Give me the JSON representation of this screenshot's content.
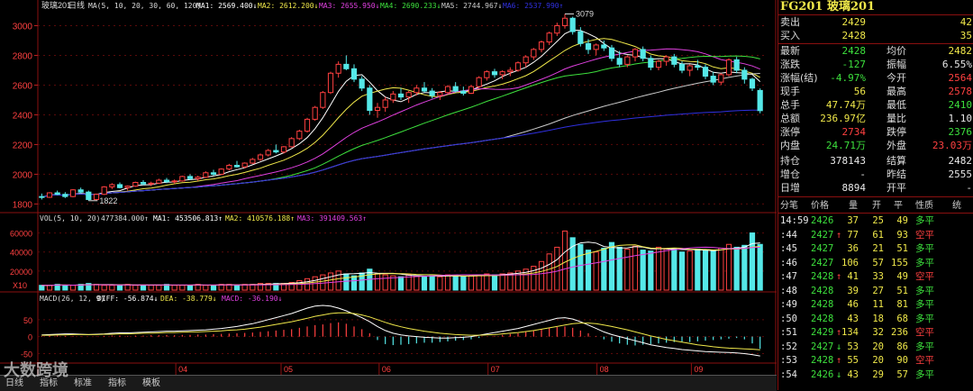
{
  "chart_title_bar": {
    "symbol": "玻璃201",
    "period": "日线",
    "ma_spec": "MA(5, 10, 20, 30, 60, 120)",
    "ma_values": [
      {
        "name": "MA1:",
        "value": "2569.400",
        "arrow": "↓",
        "color": "#ffffff"
      },
      {
        "name": "MA2:",
        "value": "2612.200",
        "arrow": "↓",
        "color": "#f0e84a"
      },
      {
        "name": "MA3:",
        "value": "2655.950",
        "arrow": "↓",
        "color": "#e040e0"
      },
      {
        "name": "MA4:",
        "value": "2690.233",
        "arrow": "↓",
        "color": "#3de03d"
      },
      {
        "name": "MA5:",
        "value": "2744.967",
        "arrow": "↓",
        "color": "#cccccc"
      },
      {
        "name": "MA6:",
        "value": "2537.990",
        "arrow": "↑",
        "color": "#3030e0"
      }
    ]
  },
  "vol_title_bar": {
    "spec": "VOL(5, 10, 20)",
    "value": "477384.000",
    "arrow": "↑",
    "ma_values": [
      {
        "name": "MA1:",
        "value": "453506.813",
        "arrow": "↑",
        "color": "#ffffff"
      },
      {
        "name": "MA2:",
        "value": "410576.188",
        "arrow": "↑",
        "color": "#f0e84a"
      },
      {
        "name": "MA3:",
        "value": "391409.563",
        "arrow": "↑",
        "color": "#e040e0"
      }
    ]
  },
  "macd_title_bar": {
    "spec": "MACD(26, 12, 9)",
    "diff_label": "DIFF:",
    "diff": "-56.874",
    "diff_arrow": "↓",
    "dea_label": "DEA:",
    "dea": "-38.779",
    "dea_arrow": "↓",
    "macd_label": "MACD:",
    "macd": "-36.190",
    "macd_arrow": "↓"
  },
  "price_axis_labels": [
    "3000",
    "2800",
    "2600",
    "2400",
    "2200",
    "2000",
    "1800"
  ],
  "vol_axis_labels": [
    "60000",
    "40000",
    "20000"
  ],
  "vol_unit": "X10",
  "macd_axis_labels": [
    "50",
    "0",
    "-50"
  ],
  "month_labels": [
    "04",
    "05",
    "06",
    "07",
    "08",
    "09"
  ],
  "annotations": {
    "high": "3079",
    "low": "1822"
  },
  "chart_data": {
    "type": "candlestick",
    "price_range": [
      1760,
      3100
    ],
    "ohlc": [
      [
        1850,
        1870,
        1830,
        1845
      ],
      [
        1845,
        1880,
        1840,
        1875
      ],
      [
        1875,
        1890,
        1860,
        1865
      ],
      [
        1865,
        1880,
        1840,
        1850
      ],
      [
        1850,
        1900,
        1845,
        1895
      ],
      [
        1895,
        1910,
        1870,
        1880
      ],
      [
        1880,
        1890,
        1822,
        1830
      ],
      [
        1830,
        1870,
        1825,
        1865
      ],
      [
        1865,
        1920,
        1860,
        1915
      ],
      [
        1915,
        1940,
        1900,
        1930
      ],
      [
        1930,
        1945,
        1905,
        1910
      ],
      [
        1910,
        1925,
        1890,
        1920
      ],
      [
        1920,
        1950,
        1915,
        1945
      ],
      [
        1945,
        1960,
        1925,
        1935
      ],
      [
        1935,
        1950,
        1920,
        1940
      ],
      [
        1940,
        1970,
        1935,
        1960
      ],
      [
        1960,
        1975,
        1940,
        1950
      ],
      [
        1950,
        1965,
        1935,
        1955
      ],
      [
        1955,
        1990,
        1950,
        1985
      ],
      [
        1985,
        2000,
        1960,
        1970
      ],
      [
        1970,
        1990,
        1955,
        1980
      ],
      [
        1980,
        2020,
        1975,
        2010
      ],
      [
        2010,
        2030,
        1990,
        2000
      ],
      [
        2000,
        2040,
        1995,
        2035
      ],
      [
        2035,
        2070,
        2025,
        2060
      ],
      [
        2060,
        2090,
        2045,
        2050
      ],
      [
        2050,
        2080,
        2040,
        2075
      ],
      [
        2075,
        2110,
        2070,
        2100
      ],
      [
        2100,
        2140,
        2090,
        2130
      ],
      [
        2130,
        2170,
        2120,
        2160
      ],
      [
        2160,
        2200,
        2140,
        2150
      ],
      [
        2150,
        2190,
        2140,
        2185
      ],
      [
        2185,
        2250,
        2180,
        2240
      ],
      [
        2240,
        2300,
        2230,
        2290
      ],
      [
        2290,
        2380,
        2280,
        2370
      ],
      [
        2370,
        2460,
        2360,
        2450
      ],
      [
        2450,
        2560,
        2440,
        2550
      ],
      [
        2550,
        2690,
        2540,
        2680
      ],
      [
        2680,
        2760,
        2650,
        2740
      ],
      [
        2740,
        2800,
        2700,
        2710
      ],
      [
        2710,
        2740,
        2620,
        2640
      ],
      [
        2640,
        2660,
        2560,
        2580
      ],
      [
        2580,
        2600,
        2400,
        2430
      ],
      [
        2430,
        2480,
        2380,
        2450
      ],
      [
        2450,
        2520,
        2420,
        2500
      ],
      [
        2500,
        2560,
        2480,
        2540
      ],
      [
        2540,
        2580,
        2500,
        2520
      ],
      [
        2520,
        2560,
        2480,
        2550
      ],
      [
        2550,
        2600,
        2530,
        2580
      ],
      [
        2580,
        2620,
        2550,
        2560
      ],
      [
        2560,
        2580,
        2510,
        2530
      ],
      [
        2530,
        2560,
        2500,
        2550
      ],
      [
        2550,
        2600,
        2540,
        2590
      ],
      [
        2590,
        2620,
        2550,
        2560
      ],
      [
        2560,
        2590,
        2530,
        2545
      ],
      [
        2545,
        2600,
        2540,
        2590
      ],
      [
        2590,
        2660,
        2580,
        2650
      ],
      [
        2650,
        2700,
        2630,
        2690
      ],
      [
        2690,
        2710,
        2650,
        2670
      ],
      [
        2670,
        2700,
        2640,
        2690
      ],
      [
        2690,
        2720,
        2660,
        2700
      ],
      [
        2700,
        2760,
        2690,
        2750
      ],
      [
        2750,
        2800,
        2720,
        2790
      ],
      [
        2790,
        2850,
        2770,
        2840
      ],
      [
        2840,
        2900,
        2820,
        2890
      ],
      [
        2890,
        2960,
        2870,
        2950
      ],
      [
        2950,
        3020,
        2930,
        3000
      ],
      [
        3000,
        3079,
        2980,
        3050
      ],
      [
        3050,
        3060,
        2940,
        2960
      ],
      [
        2960,
        2990,
        2860,
        2880
      ],
      [
        2880,
        2910,
        2810,
        2840
      ],
      [
        2840,
        2880,
        2800,
        2870
      ],
      [
        2870,
        2900,
        2830,
        2850
      ],
      [
        2850,
        2870,
        2760,
        2780
      ],
      [
        2780,
        2830,
        2720,
        2740
      ],
      [
        2740,
        2800,
        2720,
        2790
      ],
      [
        2790,
        2850,
        2760,
        2840
      ],
      [
        2840,
        2860,
        2760,
        2780
      ],
      [
        2780,
        2800,
        2700,
        2720
      ],
      [
        2720,
        2770,
        2700,
        2760
      ],
      [
        2760,
        2800,
        2730,
        2790
      ],
      [
        2790,
        2810,
        2720,
        2740
      ],
      [
        2740,
        2760,
        2680,
        2700
      ],
      [
        2700,
        2740,
        2660,
        2730
      ],
      [
        2730,
        2770,
        2700,
        2720
      ],
      [
        2720,
        2740,
        2640,
        2660
      ],
      [
        2660,
        2690,
        2600,
        2620
      ],
      [
        2620,
        2680,
        2600,
        2670
      ],
      [
        2670,
        2780,
        2660,
        2770
      ],
      [
        2770,
        2790,
        2680,
        2700
      ],
      [
        2700,
        2720,
        2610,
        2640
      ],
      [
        2640,
        2650,
        2560,
        2580
      ],
      [
        2564,
        2578,
        2410,
        2428
      ]
    ],
    "volume": [
      5,
      5,
      6,
      5,
      5,
      6,
      7,
      6,
      5,
      5,
      5,
      6,
      5,
      5,
      5,
      5,
      6,
      5,
      5,
      5,
      6,
      5,
      5,
      6,
      6,
      5,
      6,
      6,
      7,
      7,
      7,
      7,
      8,
      10,
      12,
      14,
      16,
      18,
      20,
      17,
      15,
      18,
      22,
      17,
      16,
      15,
      14,
      16,
      15,
      14,
      15,
      14,
      16,
      15,
      14,
      15,
      16,
      17,
      16,
      17,
      18,
      20,
      22,
      25,
      30,
      38,
      45,
      62,
      55,
      48,
      42,
      40,
      44,
      50,
      45,
      43,
      46,
      42,
      41,
      45,
      43,
      44,
      40,
      41,
      43,
      42,
      41,
      44,
      48,
      45,
      47,
      60,
      48
    ],
    "macd_hist": [
      2,
      2,
      3,
      2,
      2,
      1,
      0,
      1,
      2,
      3,
      3,
      2,
      3,
      3,
      4,
      4,
      5,
      4,
      5,
      5,
      6,
      6,
      7,
      8,
      9,
      10,
      11,
      12,
      14,
      16,
      18,
      20,
      22,
      26,
      30,
      34,
      36,
      40,
      42,
      38,
      30,
      22,
      10,
      -10,
      -22,
      -25,
      -24,
      -22,
      -20,
      -18,
      -18,
      -16,
      -14,
      -12,
      -10,
      -8,
      -4,
      0,
      2,
      5,
      8,
      10,
      14,
      18,
      22,
      26,
      28,
      30,
      26,
      18,
      10,
      2,
      -8,
      -15,
      -20,
      -24,
      -26,
      -24,
      -22,
      -20,
      -18,
      -16,
      -15,
      -16,
      -14,
      -12,
      -10,
      -8,
      -6,
      -4,
      -8,
      -20,
      -36
    ],
    "diff_line": [
      5,
      6,
      7,
      8,
      8,
      7,
      6,
      7,
      8,
      10,
      11,
      11,
      12,
      13,
      14,
      15,
      16,
      16,
      17,
      18,
      19,
      20,
      22,
      24,
      27,
      30,
      34,
      38,
      44,
      50,
      56,
      62,
      68,
      76,
      84,
      90,
      92,
      90,
      84,
      76,
      66,
      56,
      44,
      30,
      18,
      10,
      5,
      2,
      0,
      -2,
      -3,
      -4,
      -4,
      -3,
      -2,
      0,
      4,
      8,
      12,
      16,
      20,
      24,
      30,
      36,
      42,
      48,
      54,
      56,
      52,
      44,
      34,
      24,
      14,
      6,
      0,
      -6,
      -12,
      -18,
      -24,
      -28,
      -32,
      -35,
      -38,
      -40,
      -42,
      -44,
      -45,
      -46,
      -47,
      -48,
      -50,
      -53,
      -57
    ],
    "dea_line": [
      4,
      4,
      5,
      5,
      6,
      6,
      6,
      6,
      7,
      7,
      8,
      8,
      9,
      10,
      10,
      11,
      12,
      12,
      13,
      14,
      14,
      15,
      16,
      17,
      19,
      20,
      22,
      25,
      28,
      32,
      36,
      40,
      44,
      49,
      54,
      60,
      64,
      68,
      70,
      70,
      68,
      64,
      58,
      50,
      42,
      35,
      29,
      24,
      20,
      16,
      13,
      10,
      8,
      6,
      5,
      4,
      4,
      5,
      6,
      8,
      10,
      12,
      15,
      18,
      22,
      26,
      30,
      34,
      38,
      40,
      40,
      38,
      34,
      30,
      25,
      20,
      14,
      8,
      2,
      -3,
      -8,
      -12,
      -16,
      -20,
      -24,
      -27,
      -30,
      -32,
      -34,
      -35,
      -36,
      -37,
      -38.8
    ]
  },
  "side_panel": {
    "code": "FG201",
    "name": "玻璃201",
    "rows": [
      {
        "l1": "卖出",
        "v1": "2429",
        "c1": "#f0e84a",
        "l2": "",
        "v2": "42",
        "c2": "#f0e84a"
      },
      {
        "l1": "买入",
        "v1": "2428",
        "c1": "#f0e84a",
        "l2": "",
        "v2": "35",
        "c2": "#f0e84a"
      },
      {
        "l1": "最新",
        "v1": "2428",
        "c1": "#3de03d",
        "l2": "均价",
        "v2": "2482",
        "c2": "#f0e84a"
      },
      {
        "l1": "涨跌",
        "v1": "-127",
        "c1": "#3de03d",
        "l2": "振幅",
        "v2": "6.55%",
        "c2": "#e8e8e8"
      },
      {
        "l1": "涨幅(结)",
        "v1": "-4.97%",
        "c1": "#3de03d",
        "l2": "今开",
        "v2": "2564",
        "c2": "#ff4040"
      },
      {
        "l1": "现手",
        "v1": "56",
        "c1": "#f0e84a",
        "l2": "最高",
        "v2": "2578",
        "c2": "#ff4040"
      },
      {
        "l1": "总手",
        "v1": "47.74万",
        "c1": "#f0e84a",
        "l2": "最低",
        "v2": "2410",
        "c2": "#3de03d"
      },
      {
        "l1": "总额",
        "v1": "236.97亿",
        "c1": "#f0e84a",
        "l2": "量比",
        "v2": "1.10",
        "c2": "#e8e8e8"
      },
      {
        "l1": "涨停",
        "v1": "2734",
        "c1": "#ff4040",
        "l2": "跌停",
        "v2": "2376",
        "c2": "#3de03d"
      },
      {
        "l1": "内盘",
        "v1": "24.71万",
        "c1": "#3de03d",
        "l2": "外盘",
        "v2": "23.03万",
        "c2": "#ff4040"
      },
      {
        "l1": "持仓",
        "v1": "378143",
        "c1": "#e8e8e8",
        "l2": "结算",
        "v2": "2482",
        "c2": "#e8e8e8"
      },
      {
        "l1": "增仓",
        "v1": "-",
        "c1": "#e8e8e8",
        "l2": "昨结",
        "v2": "2555",
        "c2": "#e8e8e8"
      },
      {
        "l1": "日增",
        "v1": "8894",
        "c1": "#e8e8e8",
        "l2": "开平",
        "v2": "-",
        "c2": "#e8e8e8"
      }
    ],
    "tick_headers": [
      "分笔",
      "价格",
      "量",
      "开",
      "平",
      "性质",
      "统"
    ],
    "ticks": [
      {
        "time": "14:59",
        "price": "2426",
        "arrow": "",
        "vol": "37",
        "open": "25",
        "close": "49",
        "nature": "多平",
        "nc": "#3de03d"
      },
      {
        "time": ":44",
        "price": "2427",
        "arrow": "↑",
        "vol": "77",
        "open": "61",
        "close": "93",
        "nature": "空平",
        "nc": "#ff4040"
      },
      {
        "time": ":45",
        "price": "2427",
        "arrow": "",
        "vol": "36",
        "open": "21",
        "close": "51",
        "nature": "多平",
        "nc": "#3de03d"
      },
      {
        "time": ":46",
        "price": "2427",
        "arrow": "",
        "vol": "106",
        "open": "57",
        "close": "155",
        "nature": "多平",
        "nc": "#3de03d"
      },
      {
        "time": ":47",
        "price": "2428",
        "arrow": "↑",
        "vol": "41",
        "open": "33",
        "close": "49",
        "nature": "空平",
        "nc": "#ff4040"
      },
      {
        "time": ":48",
        "price": "2428",
        "arrow": "",
        "vol": "39",
        "open": "27",
        "close": "51",
        "nature": "多平",
        "nc": "#3de03d"
      },
      {
        "time": ":49",
        "price": "2428",
        "arrow": "",
        "vol": "46",
        "open": "11",
        "close": "81",
        "nature": "多平",
        "nc": "#3de03d"
      },
      {
        "time": ":50",
        "price": "2428",
        "arrow": "",
        "vol": "43",
        "open": "18",
        "close": "68",
        "nature": "多平",
        "nc": "#3de03d"
      },
      {
        "time": ":51",
        "price": "2429",
        "arrow": "↑",
        "vol": "134",
        "open": "32",
        "close": "236",
        "nature": "空平",
        "nc": "#ff4040"
      },
      {
        "time": ":52",
        "price": "2427",
        "arrow": "↓",
        "vol": "53",
        "open": "20",
        "close": "86",
        "nature": "多平",
        "nc": "#3de03d"
      },
      {
        "time": ":53",
        "price": "2428",
        "arrow": "↑",
        "vol": "55",
        "open": "20",
        "close": "90",
        "nature": "空平",
        "nc": "#ff4040"
      },
      {
        "time": ":54",
        "price": "2426",
        "arrow": "↓",
        "vol": "43",
        "open": "29",
        "close": "57",
        "nature": "多平",
        "nc": "#3de03d"
      }
    ]
  },
  "watermark": "大数跨境",
  "bottom_tabs": [
    "日线",
    "指标",
    "标准",
    "指标",
    "模板"
  ]
}
